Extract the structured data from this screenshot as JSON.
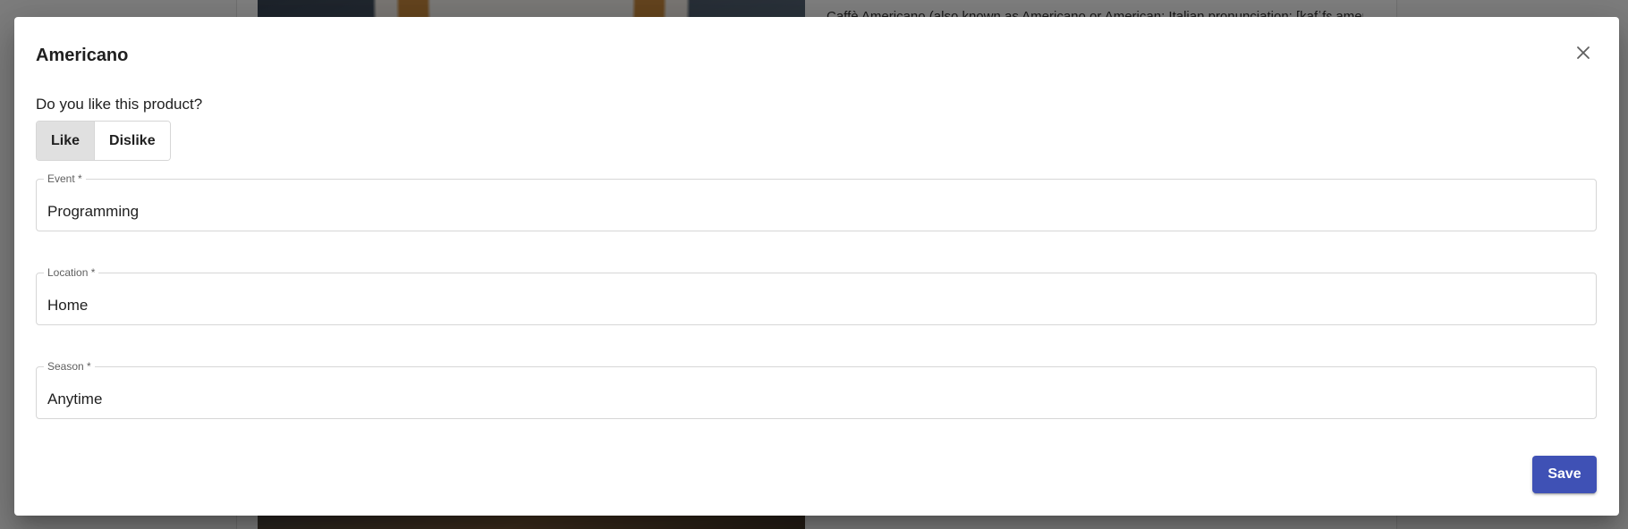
{
  "background": {
    "description_text": "Caffè Americano (also known as Americano or American; Italian pronunciation: [kafˈfɛ ameri"
  },
  "dialog": {
    "title": "Americano",
    "question": "Do you like this product?",
    "toggle": {
      "like_label": "Like",
      "dislike_label": "Dislike",
      "selected": "Like"
    },
    "fields": {
      "event": {
        "label": "Event *",
        "value": "Programming"
      },
      "location": {
        "label": "Location *",
        "value": "Home"
      },
      "season": {
        "label": "Season *",
        "value": "Anytime"
      }
    },
    "save_label": "Save",
    "close_icon": "close-icon"
  },
  "colors": {
    "primary": "#3f51b5",
    "toggle_selected_bg": "#e0e0e0",
    "overlay": "rgba(0,0,0,0.5)"
  }
}
